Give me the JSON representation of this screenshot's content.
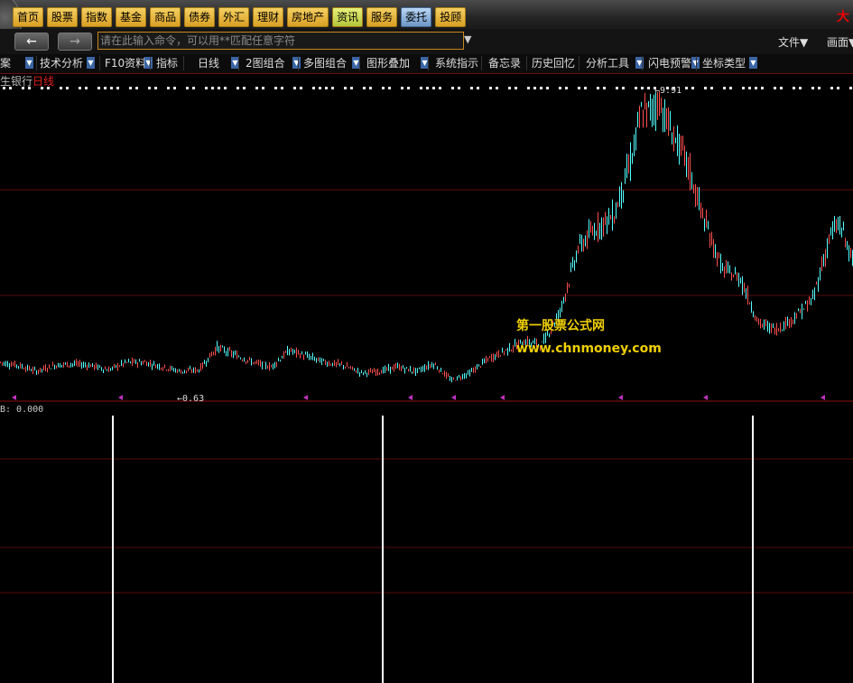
{
  "nav": {
    "buttons": [
      {
        "label": "首页",
        "style": "gold"
      },
      {
        "label": "股票",
        "style": "gold"
      },
      {
        "label": "指数",
        "style": "gold"
      },
      {
        "label": "基金",
        "style": "gold"
      },
      {
        "label": "商品",
        "style": "gold"
      },
      {
        "label": "债券",
        "style": "gold"
      },
      {
        "label": "外汇",
        "style": "gold"
      },
      {
        "label": "理财",
        "style": "gold"
      },
      {
        "label": "房地产",
        "style": "gold"
      },
      {
        "label": "资讯",
        "style": "green"
      },
      {
        "label": "服务",
        "style": "gold"
      },
      {
        "label": "委托",
        "style": "blue"
      },
      {
        "label": "投顾",
        "style": "gold"
      }
    ],
    "brand_glyph": "大"
  },
  "command": {
    "placeholder": "请在此输入命令，可以用**匹配任意字符",
    "back_icon": "←",
    "forward_icon": "→",
    "dropdown_icon": "▼",
    "file_menu": "文件▼",
    "view_menu": "画面▼"
  },
  "toolbar": {
    "items": [
      "案",
      "技术分析",
      "F10资料",
      "指标",
      "日线",
      "2图组合",
      "多图组合",
      "图形叠加",
      "系统指示",
      "备忘录",
      "历史回忆",
      "分析工具",
      "闪电预警",
      "坐标类型"
    ],
    "arrow_icon": "▼"
  },
  "chart": {
    "stock_name": "生银行",
    "period": "日线",
    "high_label": "9.91",
    "low_label": "0.63",
    "watermark_name": "第一股票公式网",
    "watermark_url": "www.chnmoney.com",
    "up_color": "#ff5050",
    "down_color": "#54ffff",
    "grid_color": "#5a0d0d",
    "marker_color": "#c030c0"
  },
  "sub_chart": {
    "label": "B: 0.000",
    "signal_color": "#ffffff"
  },
  "chart_data": {
    "type": "line",
    "title": "",
    "series_label": "生银行 日线",
    "x": [
      0,
      20,
      40,
      60,
      80,
      100,
      120,
      140,
      160,
      180,
      200,
      220,
      240,
      260,
      280,
      300,
      320,
      340,
      360,
      380,
      400,
      420,
      440,
      460,
      480,
      500,
      520,
      540,
      560,
      580,
      600,
      620,
      640,
      660,
      680,
      700,
      710,
      720,
      730,
      740,
      760,
      780,
      800,
      820,
      840,
      860,
      880,
      900,
      920,
      930,
      945
    ],
    "values": [
      0.9,
      0.8,
      0.6,
      0.8,
      0.85,
      0.8,
      0.65,
      0.9,
      0.9,
      0.75,
      0.6,
      0.65,
      1.4,
      1.15,
      0.9,
      0.75,
      1.3,
      1.1,
      0.9,
      0.8,
      0.55,
      0.6,
      0.75,
      0.6,
      0.85,
      0.3,
      0.55,
      1.0,
      1.3,
      1.6,
      1.5,
      2.6,
      4.7,
      5.4,
      5.8,
      7.8,
      9.2,
      9.3,
      9.6,
      8.8,
      7.6,
      5.6,
      4.0,
      3.7,
      2.2,
      2.0,
      2.4,
      3.0,
      5.2,
      5.5,
      4.2
    ],
    "ylim": [
      0,
      10
    ],
    "grid": true
  }
}
